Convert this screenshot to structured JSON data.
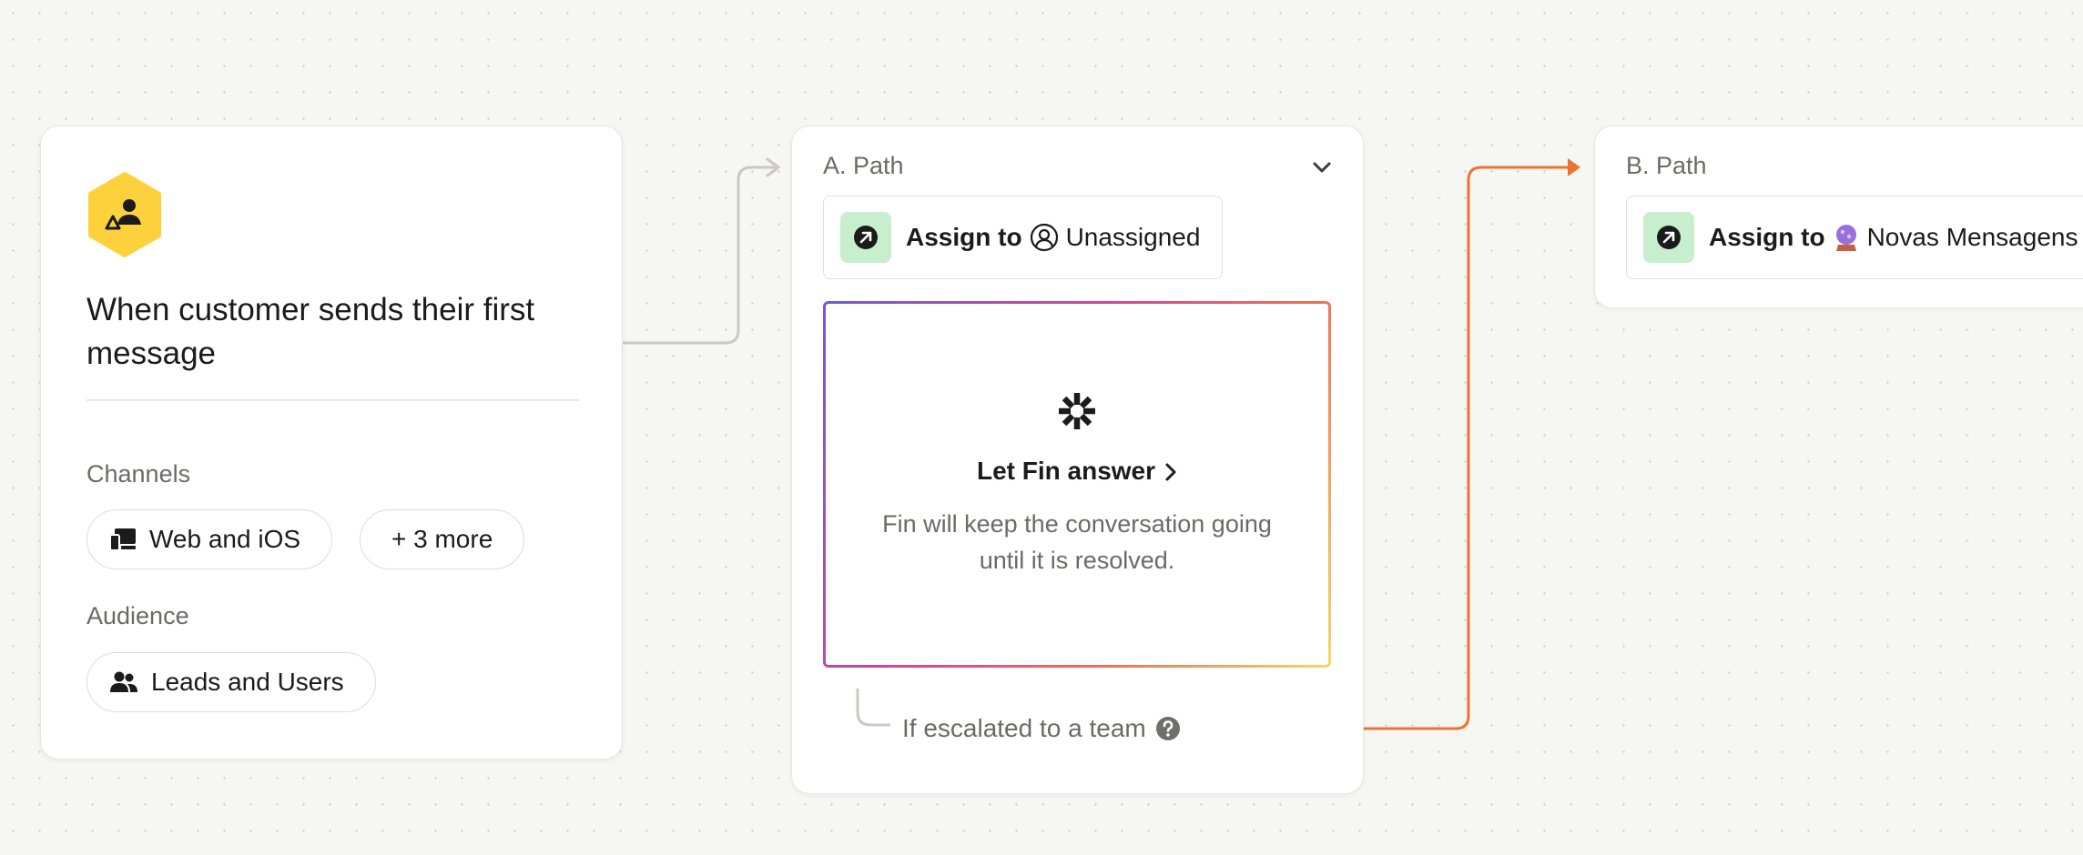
{
  "trigger": {
    "title": "When customer sends their first message",
    "channels_label": "Channels",
    "channels": [
      "Web and iOS",
      "+ 3 more"
    ],
    "audience_label": "Audience",
    "audience": "Leads and Users"
  },
  "path_a": {
    "label": "A. Path",
    "assign_label": "Assign to",
    "assign_value": "Unassigned",
    "fin_title": "Let Fin answer",
    "fin_description": "Fin will keep the conversation going until it is resolved.",
    "escalation": "If escalated to a team"
  },
  "path_b": {
    "label": "B. Path",
    "assign_label": "Assign to",
    "assign_value": "Novas Mensagens"
  },
  "colors": {
    "trigger_icon_bg": "#fdd13b",
    "connector_gray": "#c9c8c4",
    "connector_orange": "#ec7433",
    "assign_icon_bg": "#c7efcd"
  },
  "icons": [
    "trigger-hex-icon",
    "channels-icon",
    "users-icon",
    "chevron-down-icon",
    "assign-icon",
    "person-circle-icon",
    "fin-icon",
    "chevron-right-icon",
    "help-icon",
    "team-avatar-icon"
  ]
}
